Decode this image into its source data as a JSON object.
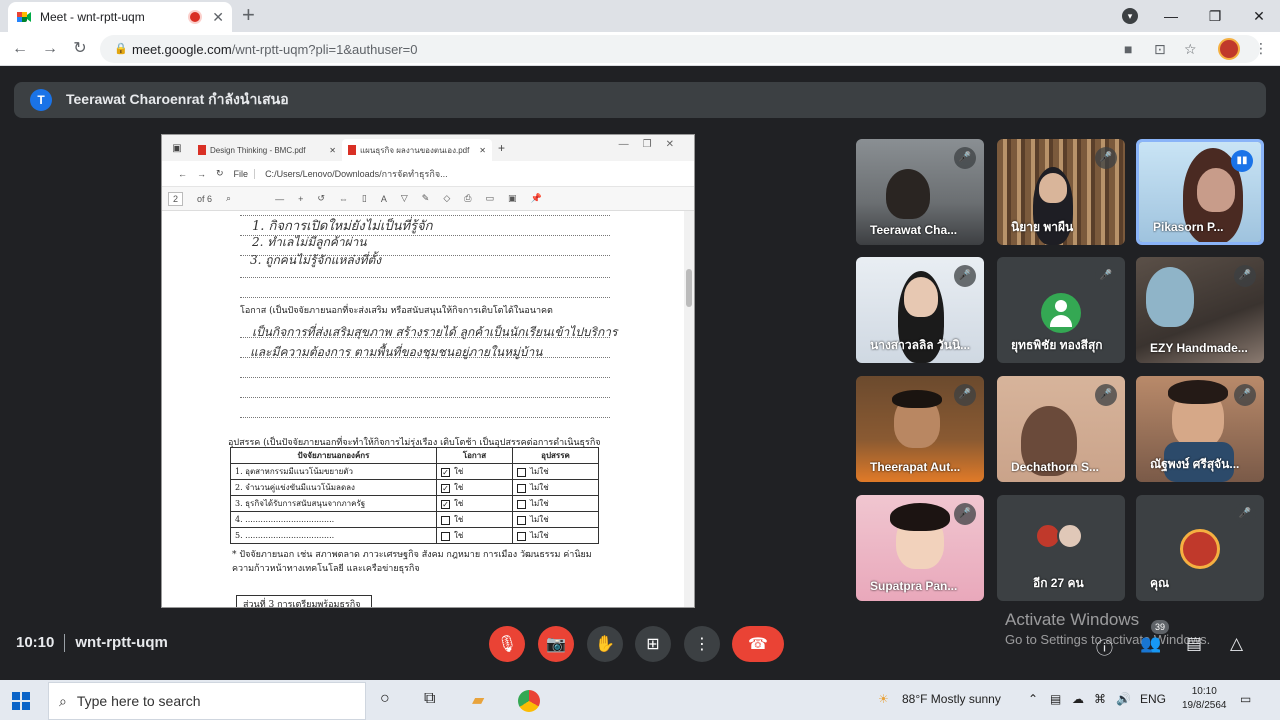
{
  "browser": {
    "tab_title": "Meet - wnt-rptt-uqm",
    "url_host": "meet.google.com",
    "url_path": "/wnt-rptt-uqm?pli=1&authuser=0"
  },
  "meet": {
    "presenting_text": "Teerawat Charoenrat กำลังนำเสนอ",
    "presenter_initial": "T",
    "time": "10:10",
    "meeting_code": "wnt-rptt-uqm",
    "participant_count": "39"
  },
  "shared_screen": {
    "tab1": "Design Thinking - BMC.pdf",
    "tab2": "แผนธุรกิจ ผลงานของตนเอง.pdf",
    "addr_file": "File",
    "addr_path": "C:/Users/Lenovo/Downloads/การจัดทำธุรกิจ...",
    "page_num": "2",
    "page_of": "of 6",
    "handwriting_top": [
      "1. กิจการเปิดใหม่ยังไม่เป็นที่รู้จัก",
      "2. ทำเลไม่มีลูกค้าผ่าน",
      "3. ถูกคนไม่รู้จักแหล่งที่ตั้ง"
    ],
    "opportunity_heading": "โอกาส (เป็นปัจจัยภายนอกที่จะส่งเสริม หรือสนับสนุนให้กิจการเติบโตได้ในอนาคต",
    "handwriting_opp": [
      "เป็นกิจการที่ส่งเสริมสุขภาพ สร้างรายได้ ลูกค้าเป็นนักเรียนเข้าไปบริการ",
      "และมีความต้องการ ตามพื้นที่ของชุมชนอยู่ภายในหมู่บ้าน"
    ],
    "threat_heading": "อุปสรรค (เป็นปัจจัยภายนอกที่จะทำให้กิจการไม่รุ่งเรือง เติบโตช้า เป็นอุปสรรคต่อการดำเนินธุรกิจ",
    "table_headers": [
      "ปัจจัยภายนอกองค์กร",
      "โอกาส",
      "อุปสรรค"
    ],
    "table_rows": [
      {
        "factor": "1. อุตสาหกรรมมีแนวโน้มขยายตัว",
        "opp": "ใช่",
        "threat": "ไม่ใช่",
        "checked": true
      },
      {
        "factor": "2. จำนวนคู่แข่งขันมีแนวโน้มลดลง",
        "opp": "ใช่",
        "threat": "ไม่ใช่",
        "checked": true
      },
      {
        "factor": "3. ธุรกิจได้รับการสนับสนุนจากภาครัฐ",
        "opp": "ใช่",
        "threat": "ไม่ใช่",
        "checked": true
      },
      {
        "factor": "4. ...................................",
        "opp": "ใช่",
        "threat": "ไม่ใช่",
        "checked": false
      },
      {
        "factor": "5. ...................................",
        "opp": "ใช่",
        "threat": "ไม่ใช่",
        "checked": false
      }
    ],
    "footnote_1": "* ปัจจัยภายนอก เช่น สภาพตลาด ภาวะเศรษฐกิจ สังคม กฎหมาย การเมือง วัฒนธรรม ค่านิยม",
    "footnote_2": "ความก้าวหน้าทางเทคโนโลยี และเครือข่ายธุรกิจ",
    "section_box": "ส่วนที่ 3 การเตรียมพร้อมธุรกิจ"
  },
  "participants": [
    {
      "name": "Teerawat Cha...",
      "muted": true
    },
    {
      "name": "นิยาย พาผืน",
      "muted": true
    },
    {
      "name": "Pikasorn P...",
      "muted": false,
      "speaking": true
    },
    {
      "name": "นางสาวลลิล วันนิ...",
      "muted": true
    },
    {
      "name": "ยุทธพิชัย ทองสีสุก",
      "muted": true
    },
    {
      "name": "EZY Handmade...",
      "muted": true
    },
    {
      "name": "Theerapat Aut...",
      "muted": true
    },
    {
      "name": "Dechathorn S...",
      "muted": true
    },
    {
      "name": "ณัฐพงษ์ ศรีสุจัน...",
      "muted": true
    },
    {
      "name": "Supatpra Pan...",
      "muted": true
    },
    {
      "name": "อีก 27 คน",
      "muted": false
    },
    {
      "name": "คุณ",
      "muted": true
    }
  ],
  "activate": {
    "line1": "Activate Windows",
    "line2": "Go to Settings to activate Windows."
  },
  "taskbar": {
    "search_placeholder": "Type here to search",
    "weather": "88°F  Mostly sunny",
    "lang": "ENG",
    "time": "10:10",
    "date": "19/8/2564"
  },
  "colors": {
    "meet_bg": "#202124",
    "end_call": "#ea4335",
    "accent": "#1a73e8"
  }
}
